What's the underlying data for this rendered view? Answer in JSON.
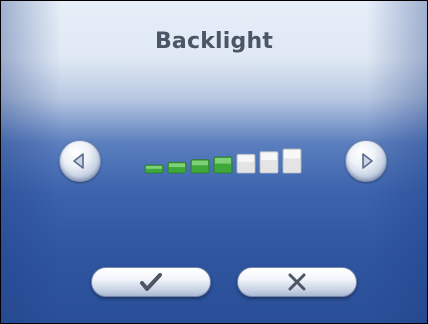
{
  "dialog": {
    "title": "Backlight"
  },
  "backlight": {
    "level": 4,
    "max_level": 7
  },
  "controls": {
    "decrease_icon": "triangle-left-icon",
    "increase_icon": "triangle-right-icon",
    "ok_icon": "checkmark-icon",
    "cancel_icon": "x-icon"
  },
  "colors": {
    "filled_segment": "#3fa83a",
    "empty_segment": "#e4e4e4",
    "title_text": "#4a5566"
  }
}
